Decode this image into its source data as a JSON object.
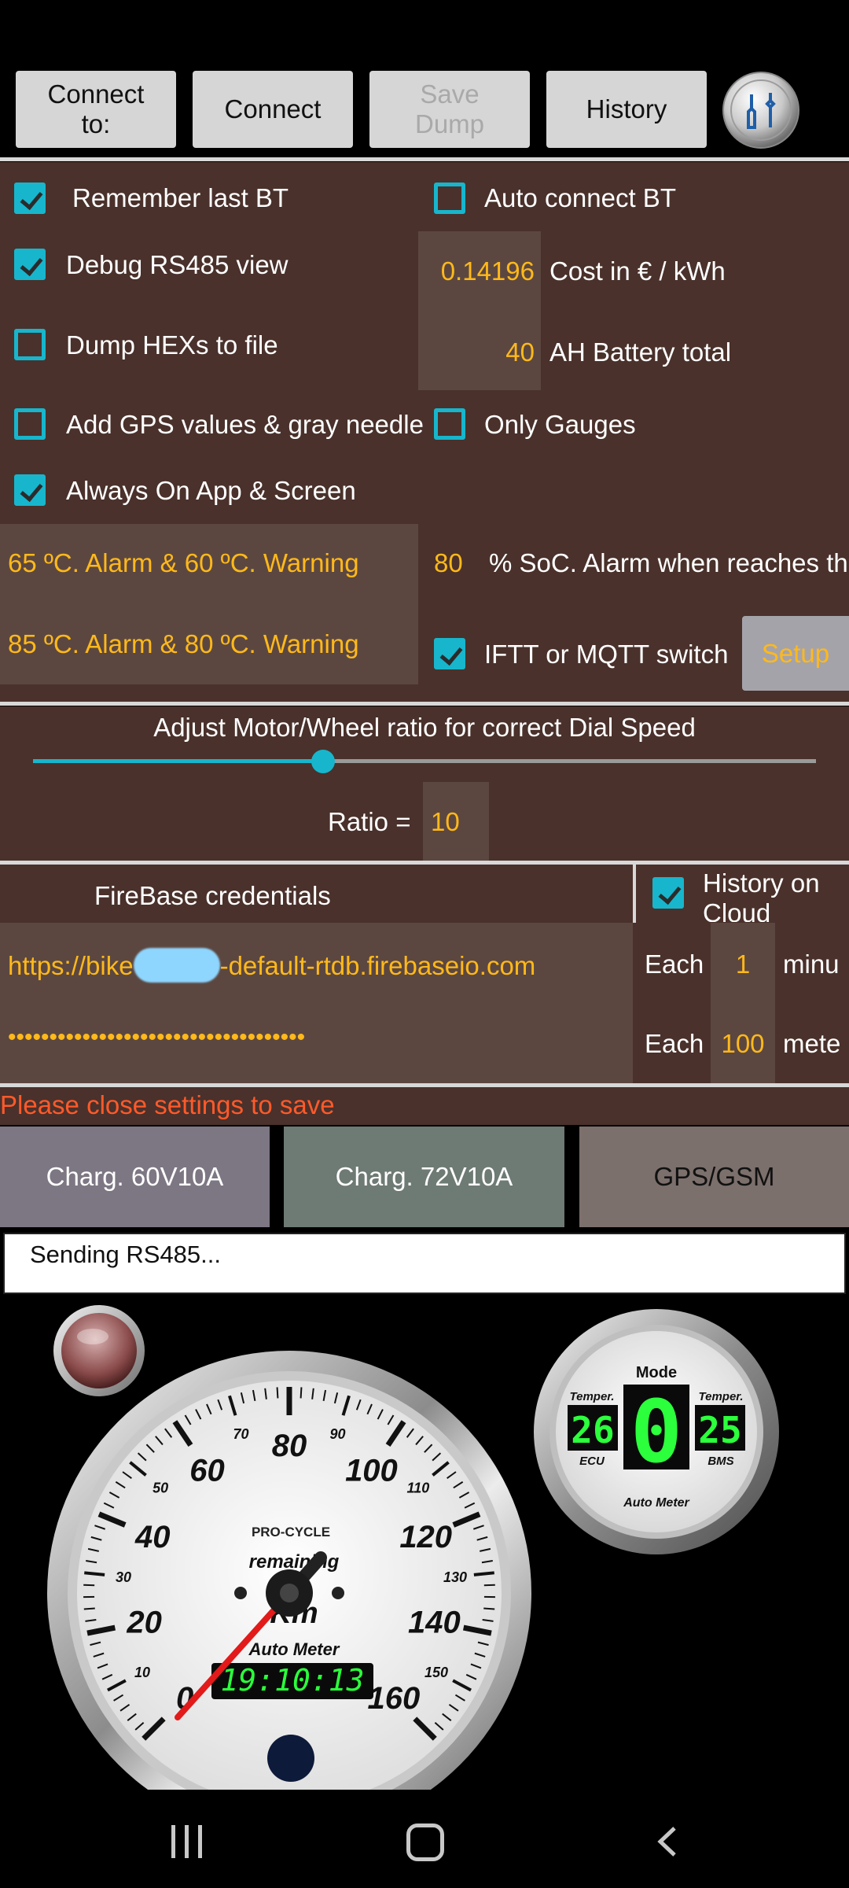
{
  "toolbar": {
    "connect_to": "Connect to:",
    "connect": "Connect",
    "save_dump": "Save Dump",
    "history": "History"
  },
  "settings": {
    "remember_bt": {
      "label": "Remember last BT",
      "checked": true
    },
    "auto_connect_bt": {
      "label": "Auto connect BT",
      "checked": false
    },
    "debug_rs485": {
      "label": "Debug RS485 view",
      "checked": true
    },
    "dump_hex": {
      "label": "Dump HEXs to file",
      "checked": false
    },
    "add_gps": {
      "label": "Add GPS values & gray needle",
      "checked": false
    },
    "only_gauges": {
      "label": "Only Gauges",
      "checked": false
    },
    "always_on": {
      "label": "Always On App & Screen",
      "checked": true
    },
    "cost": {
      "value": "0.14196",
      "label": "Cost in € / kWh"
    },
    "battery": {
      "value": "40",
      "label": "AH Battery total"
    },
    "temp_alarm_1": "65 ºC. Alarm & 60 ºC. Warning",
    "temp_alarm_2": "85 ºC. Alarm & 80 ºC. Warning",
    "soc": {
      "value": "80",
      "label": "% SoC. Alarm when reaches th"
    },
    "ifttt": {
      "label": "IFTT or MQTT switch",
      "checked": true
    },
    "setup_button": "Setup"
  },
  "ratio": {
    "title": "Adjust Motor/Wheel ratio for correct Dial Speed",
    "label": "Ratio  =",
    "value": "10",
    "slider_fraction": 0.37
  },
  "firebase": {
    "title": "FireBase credentials",
    "history_cloud": {
      "label_line1": "History on",
      "label_line2": "Cloud",
      "checked": true
    },
    "url_prefix": "https://bike",
    "url_suffix": "-default-rtdb.firebaseio.com",
    "password": "••••••••••••••••••••••••••••••••••••",
    "each_label": "Each",
    "minutes_value": "1",
    "minutes_unit": "minu",
    "meters_value": "100",
    "meters_unit": "mete"
  },
  "notice": "Please close settings to save",
  "tabs": [
    "Charg. 60V10A",
    "Charg. 72V10A",
    "GPS/GSM"
  ],
  "log_text": "Sending RS485...",
  "speedometer": {
    "major_ticks": [
      "0",
      "20",
      "40",
      "60",
      "80",
      "100",
      "120",
      "140",
      "160"
    ],
    "minor_ticks": [
      "10",
      "30",
      "50",
      "70",
      "90",
      "110",
      "130",
      "150"
    ],
    "brand_top": "PRO-CYCLE",
    "remaining": "remaining",
    "unit": "Km",
    "brand": "Auto Meter",
    "clock": "19:10:13"
  },
  "mode_gauge": {
    "title": "Mode",
    "left_label": "Temper.",
    "left_value": "26",
    "left_sub": "ECU",
    "mode_value": "0",
    "right_label": "Temper.",
    "right_value": "25",
    "right_sub": "BMS",
    "brand": "Auto Meter"
  },
  "colors": {
    "accent": "#17b6cc",
    "value": "#ffb91a",
    "panel": "#4a312b",
    "notice": "#ff5a2a"
  }
}
